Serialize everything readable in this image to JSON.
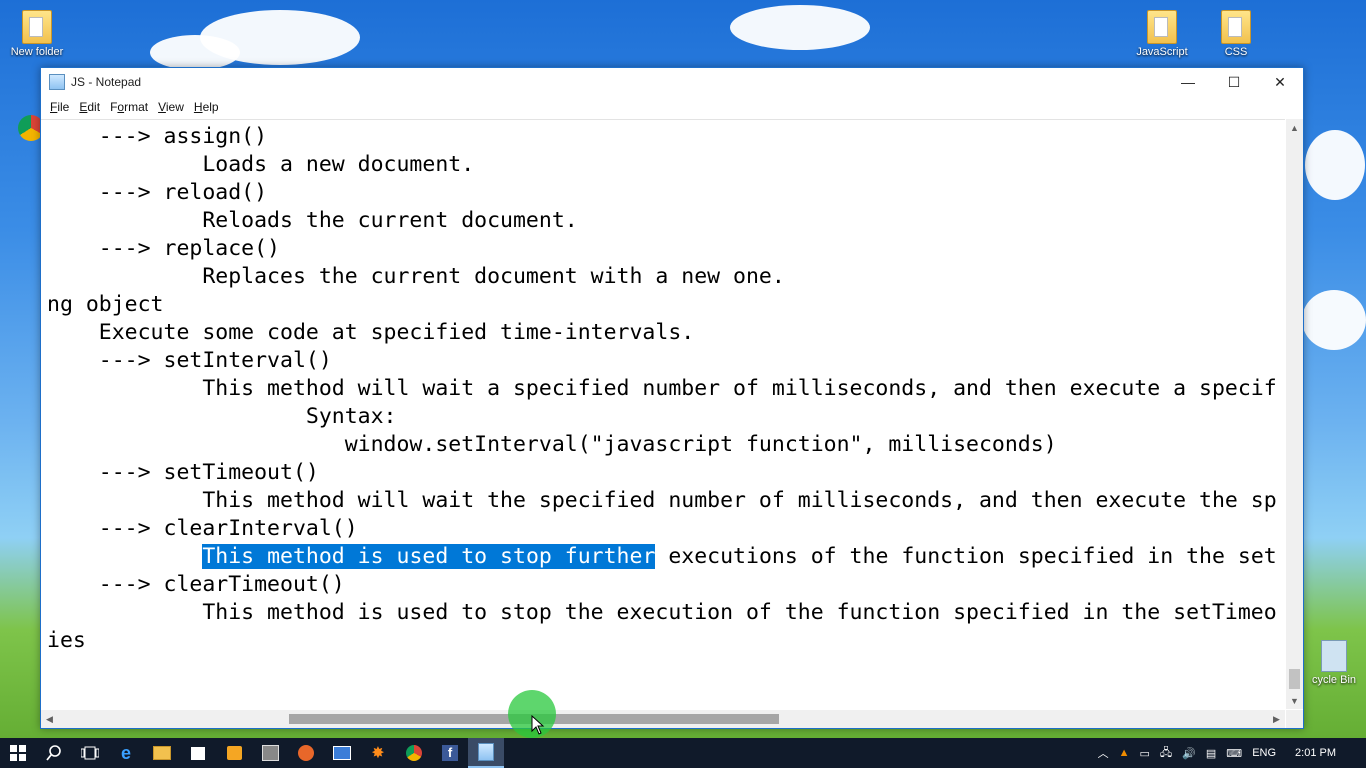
{
  "desktop": {
    "icons": [
      {
        "label": "New folder"
      },
      {
        "label": "JavaScript"
      },
      {
        "label": "CSS"
      },
      {
        "label": "cycle Bin"
      }
    ]
  },
  "window": {
    "title": "JS - Notepad",
    "menu": [
      {
        "label": "File",
        "key": "F",
        "rest": "ile"
      },
      {
        "label": "Edit",
        "key": "E",
        "rest": "dit"
      },
      {
        "label": "Format",
        "key": "o",
        "pre": "F",
        "rest": "rmat"
      },
      {
        "label": "View",
        "key": "V",
        "rest": "iew"
      },
      {
        "label": "Help",
        "key": "H",
        "rest": "elp"
      }
    ],
    "controls": {
      "minimize": "—",
      "maximize": "☐",
      "close": "✕"
    }
  },
  "editor": {
    "lines": [
      "    ---> assign()",
      "            Loads a new document.",
      "    ---> reload()",
      "            Reloads the current document.",
      "    ---> replace()",
      "            Replaces the current document with a new one.",
      "ng object",
      "    Execute some code at specified time-intervals.",
      "    ---> setInterval()",
      "            This method will wait a specified number of milliseconds, and then execute a specif",
      "                    Syntax:",
      "                       window.setInterval(\"javascript function\", milliseconds)",
      "    ---> setTimeout()",
      "            This method will wait the specified number of milliseconds, and then execute the sp",
      "    ---> clearInterval()",
      "            ",
      "    ---> clearTimeout()",
      "            This method is used to stop the execution of the function specified in the setTimeo",
      "ies"
    ],
    "selected_line": {
      "prefix": "            ",
      "selected": "This method is used to stop further",
      "rest": " executions of the function specified in the set"
    }
  },
  "taskbar": {
    "tray": {
      "language": "ENG",
      "time": "2:01 PM"
    }
  }
}
